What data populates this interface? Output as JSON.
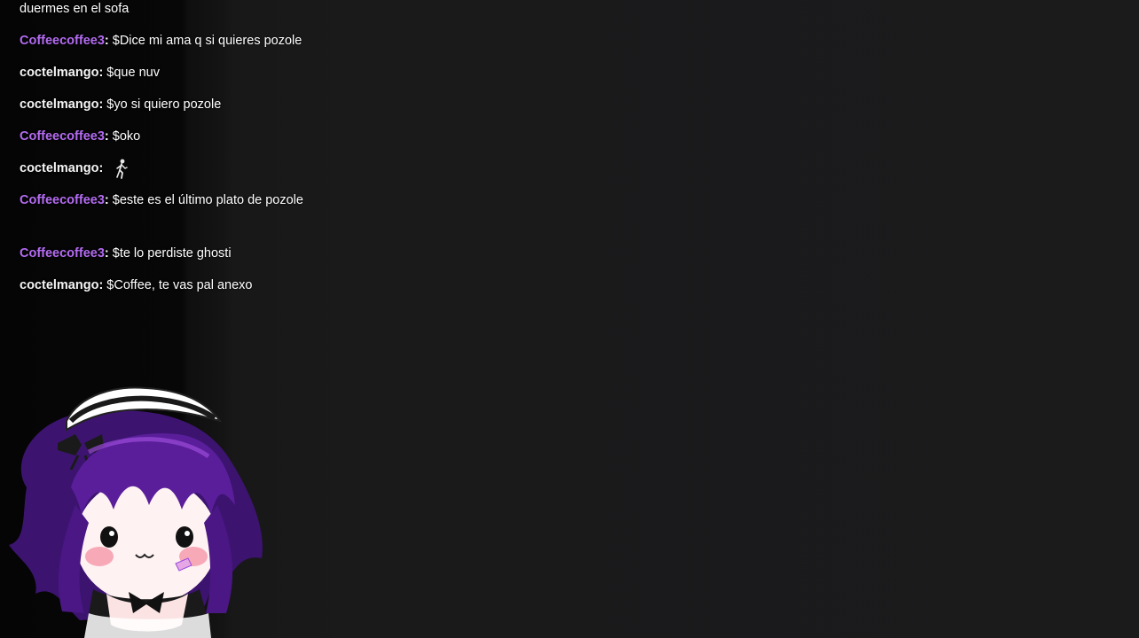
{
  "chat": {
    "messages": [
      {
        "user": "",
        "text": "duermes en el sofa",
        "color": "white"
      },
      {
        "user": "Coffeecoffee3",
        "text": "$Dice mi ama q si quieres pozole",
        "color": "purple"
      },
      {
        "user": "coctelmango",
        "text": "$que nuv",
        "color": "white"
      },
      {
        "user": "coctelmango",
        "text": "$yo si quiero pozole",
        "color": "white"
      },
      {
        "user": "Coffeecoffee3",
        "text": "$oko",
        "color": "purple"
      },
      {
        "user": "coctelmango",
        "text": "",
        "color": "white",
        "emote": "walking-figure-emote"
      },
      {
        "user": "Coffeecoffee3",
        "text": "$este es el último plato de pozole",
        "color": "purple"
      },
      {
        "user": "Coffeecoffee3",
        "text": "$te lo perdiste ghosti",
        "color": "purple"
      },
      {
        "user": "coctelmango",
        "text": "$Coffee, te vas pal anexo",
        "color": "white"
      }
    ]
  },
  "colors": {
    "background": "#1b1b1c",
    "chat_panel": "#060606",
    "username_purple": "#b46cf2",
    "username_white": "#f4f4f4",
    "hair_purple": "#5a1e9a"
  },
  "mascot": {
    "icon": "maid-avatar-icon"
  }
}
